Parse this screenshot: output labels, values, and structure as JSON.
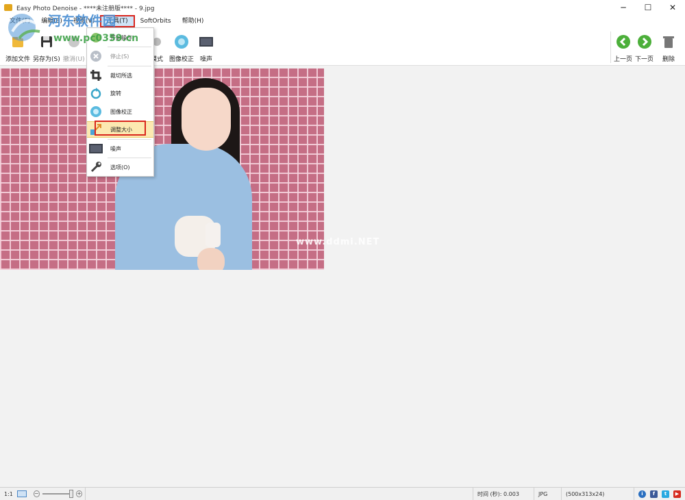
{
  "window": {
    "title": "Easy Photo Denoise - ****未注册版**** - 9.jpg",
    "minimize": "─",
    "maximize": "☐",
    "close": "✕"
  },
  "menubar": {
    "items": [
      {
        "label": "文件(F)"
      },
      {
        "label": "编辑(E)"
      },
      {
        "label": "视图(V)"
      },
      {
        "label": "工具(T)"
      },
      {
        "label": "SoftOrbits"
      },
      {
        "label": "帮助(H)"
      }
    ]
  },
  "toolbar": {
    "add_file": "添加文件",
    "save_as": "另存为(S)",
    "undo": "撤消(U)",
    "mode": "模式",
    "image_correction": "图像校正",
    "noise": "噪声",
    "prev": "上一页",
    "next": "下一页",
    "delete": "删除"
  },
  "tools_menu": {
    "items": [
      {
        "label": "开始操作",
        "icon": "play-icon"
      },
      {
        "label": "停止(S)",
        "icon": "stop-icon"
      },
      {
        "label": "裁切所选",
        "icon": "crop-icon"
      },
      {
        "label": "旋转",
        "icon": "rotate-icon"
      },
      {
        "label": "图像校正",
        "icon": "snowflake-icon"
      },
      {
        "label": "调整大小",
        "icon": "resize-icon"
      },
      {
        "label": "噪声",
        "icon": "noise-icon"
      },
      {
        "label": "选项(O)",
        "icon": "wrench-icon"
      }
    ]
  },
  "watermark": {
    "site_name": "河东软件园",
    "url": "www.pc0359.cn",
    "photo_mark": "www.ddmi.NET"
  },
  "statusbar": {
    "zoom_label": "1:1",
    "zoom_fraction": 0.62,
    "time": "时间 (秒): 0.003",
    "format": "JPG",
    "dimensions": "(500x313x24)"
  },
  "colors": {
    "highlight_red": "#d9241c",
    "menu_highlight": "#fce9b1",
    "nav_green": "#4caf3a"
  }
}
